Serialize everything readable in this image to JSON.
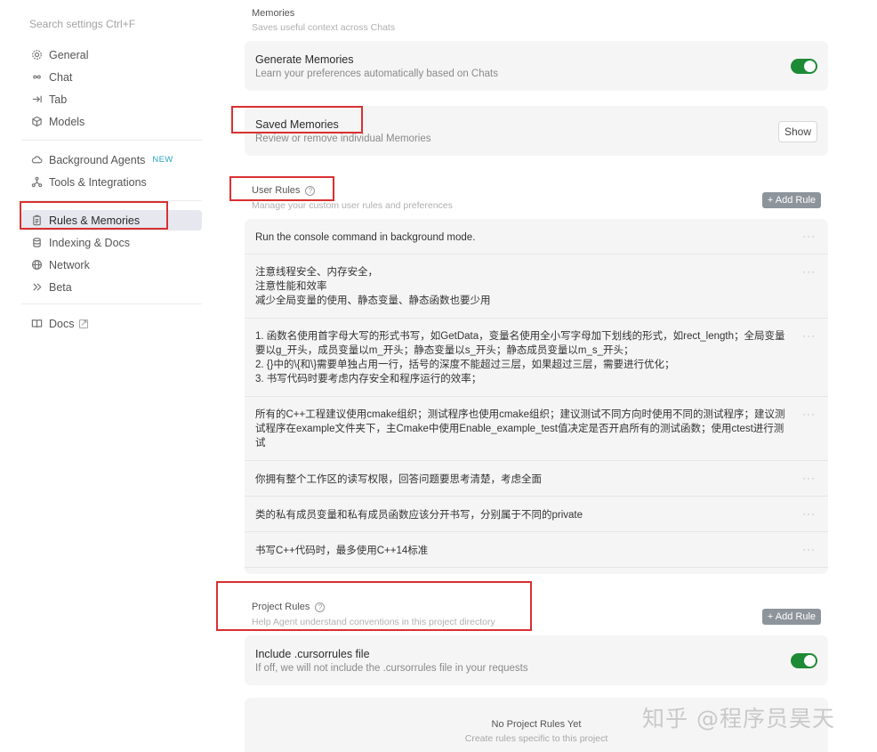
{
  "sidebar": {
    "search_placeholder": "Search settings Ctrl+F",
    "items": [
      {
        "label": "General",
        "icon": "gear-icon"
      },
      {
        "label": "Chat",
        "icon": "infinity-icon"
      },
      {
        "label": "Tab",
        "icon": "tab-arrow-icon"
      },
      {
        "label": "Models",
        "icon": "cube-icon"
      },
      {
        "label": "Background Agents",
        "icon": "cloud-icon",
        "badge": "NEW"
      },
      {
        "label": "Tools & Integrations",
        "icon": "integrations-icon"
      },
      {
        "label": "Rules & Memories",
        "icon": "clipboard-icon",
        "active": true
      },
      {
        "label": "Indexing & Docs",
        "icon": "database-icon"
      },
      {
        "label": "Network",
        "icon": "globe-icon"
      },
      {
        "label": "Beta",
        "icon": "chevrons-icon"
      },
      {
        "label": "Docs",
        "icon": "book-icon"
      }
    ]
  },
  "memories": {
    "title": "Memories",
    "subtitle": "Saves useful context across Chats",
    "generate": {
      "title": "Generate Memories",
      "subtitle": "Learn your preferences automatically based on Chats",
      "enabled": true
    },
    "saved": {
      "title": "Saved Memories",
      "subtitle": "Review or remove individual Memories",
      "button": "Show"
    }
  },
  "user_rules": {
    "title": "User Rules",
    "subtitle": "Manage your custom user rules and preferences",
    "add_button": "+ Add Rule",
    "rules": [
      "Run the console command in background mode.",
      "注意线程安全、内存安全，\n注意性能和效率\n减少全局变量的使用、静态变量、静态函数也要少用",
      "1. 函数名使用首字母大写的形式书写，如GetData，变量名使用全小写字母加下划线的形式，如rect_length；全局变量要以g_开头，成员变量以m_开头；静态变量以s_开头；静态成员变量以m_s_开头；\n2. {}中的\\{和\\}需要单独占用一行，括号的深度不能超过三层，如果超过三层，需要进行优化；\n3. 书写代码时要考虑内存安全和程序运行的效率；",
      "所有的C++工程建议使用cmake组织；测试程序也使用cmake组织；建议测试不同方向时使用不同的测试程序；建议测试程序在example文件夹下，主Cmake中使用Enable_example_test值决定是否开启所有的测试函数；使用ctest进行测试",
      "你拥有整个工作区的读写权限，回答问题要思考清楚，考虑全面",
      "类的私有成员变量和私有成员函数应该分开书写，分别属于不同的private",
      "书写C++代码时，最多使用C++14标准"
    ],
    "more_glyph": "···"
  },
  "project_rules": {
    "title": "Project Rules",
    "subtitle": "Help Agent understand conventions in this project directory",
    "add_button": "+ Add Rule",
    "cursorrules": {
      "title": "Include .cursorrules file",
      "subtitle": "If off, we will not include the .cursorrules file in your requests",
      "enabled": true
    },
    "empty": {
      "title": "No Project Rules Yet",
      "subtitle": "Create rules specific to this project"
    }
  },
  "watermark": "知乎 @程序员昊天",
  "colors": {
    "toggle_on": "#1d8a35",
    "annotation": "#d93030",
    "active_bg": "#e6e7ef",
    "new_badge": "#2ea3c4"
  }
}
